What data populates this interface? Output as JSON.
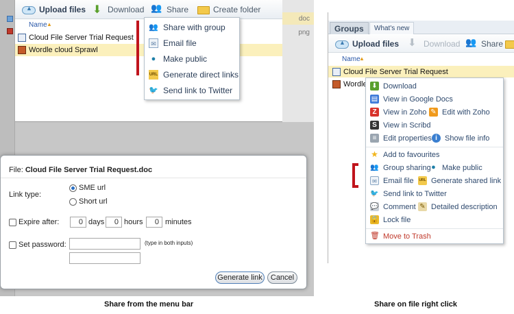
{
  "left": {
    "toolbar": {
      "upload_label": "Upload files",
      "download_label": "Download",
      "share_label": "Share",
      "create_folder_label": "Create folder"
    },
    "name_header": "Name",
    "files": [
      {
        "name": "Cloud File Server Trial Request",
        "ext": "doc",
        "icon": "doc-file-icon"
      },
      {
        "name": "Wordle cloud Sprawl",
        "ext": "png",
        "icon": "image-file-icon"
      }
    ],
    "share_menu": [
      {
        "label": "Share with group",
        "icon": "group-share-icon"
      },
      {
        "label": "Email file",
        "icon": "email-icon"
      },
      {
        "label": "Make public",
        "icon": "globe-icon"
      },
      {
        "label": "Generate direct links",
        "icon": "url-icon"
      },
      {
        "label": "Send link to Twitter",
        "icon": "twitter-icon"
      }
    ],
    "dialog": {
      "file_label": "File:",
      "file_name": "Cloud File Server Trial Request.doc",
      "link_type_label": "Link type:",
      "sme_url": "SME url",
      "short_url": "Short url",
      "expire_label": "Expire after:",
      "days_value": "0",
      "days_label": "days",
      "hours_value": "0",
      "hours_label": "hours",
      "minutes_value": "0",
      "minutes_label": "minutes",
      "password_label": "Set password:",
      "password_hint": "(type in both inputs)",
      "generate_button": "Generate link",
      "cancel_button": "Cancel"
    },
    "caption": "Share from the menu bar"
  },
  "right": {
    "tabs": [
      {
        "label": "Groups"
      },
      {
        "label": "What's new"
      }
    ],
    "toolbar": {
      "upload_label": "Upload files",
      "download_label": "Download",
      "share_label": "Share"
    },
    "name_header": "Name",
    "files": [
      {
        "name": "Cloud File Server Trial Request"
      },
      {
        "name": "Wordle"
      }
    ],
    "context_menu": {
      "download": "Download",
      "view_google_docs": "View in Google Docs",
      "view_zoho": "View in Zoho",
      "edit_zoho": "Edit with Zoho",
      "view_scribd": "View in Scribd",
      "edit_properties": "Edit properties",
      "show_file_info": "Show file info",
      "add_favourites": "Add to favourites",
      "group_sharing": "Group sharing",
      "make_public": "Make public",
      "email_file": "Email file",
      "generate_shared_link": "Generate shared link",
      "send_twitter": "Send link to Twitter",
      "comment": "Comment",
      "detailed_description": "Detailed description",
      "lock_file": "Lock file",
      "move_trash": "Move to Trash"
    },
    "caption": "Share on file right click"
  },
  "colors": {
    "highlight_row": "#fbf0bc",
    "marker_red": "#c0141c",
    "link_blue": "#2f4a6e"
  }
}
